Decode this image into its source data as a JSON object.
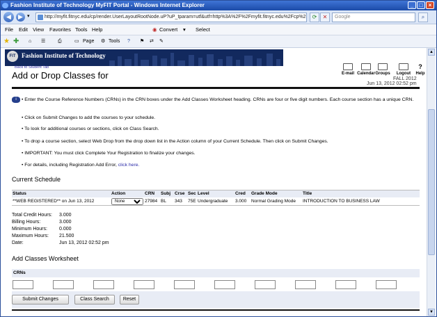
{
  "window": {
    "title": "Fashion Institute of Technology MyFIT Portal - Windows Internet Explorer",
    "min": "_",
    "max": "□",
    "close": "×"
  },
  "browser": {
    "url": "http://myfit.fitnyc.edu/cp/render.UserLayoutRootNode.uP?uP_tparam=utf&utf=http%3A%2F%2Fmyfit.fitnyc.edu%2Fcp%2",
    "search_placeholder": "Google"
  },
  "menu": [
    "File",
    "Edit",
    "View",
    "Favorites",
    "Tools",
    "Help"
  ],
  "menu_extra": {
    "convert": "Convert",
    "select": "Select"
  },
  "toolbar": {
    "page": "Page",
    "tools": "Tools"
  },
  "banner": {
    "logo": "FIT",
    "name": "Fashion Institute of Technology"
  },
  "back_link": "Back to Student Tab",
  "page_title": "Add or Drop Classes for",
  "top_tools": [
    {
      "label": "E-mail"
    },
    {
      "label": "Calendar"
    },
    {
      "label": "Groups"
    },
    {
      "label": "Logout"
    },
    {
      "label": "Help"
    }
  ],
  "term": "FALL 2012",
  "date_top": "Jun 13, 2012 02:52 pm",
  "instructions": [
    "Enter the Course Reference Numbers (CRNs) in the CRN boxes under the Add Classes Worksheet heading. CRNs are four or five digit numbers. Each course section has a unique CRN.",
    "Click on Submit Changes to add the courses to your schedule.",
    "To look for additional courses or sections, click on Class Search.",
    "To drop a course section, select Web Drop from the drop down list in the Action column of your Current Schedule. Then click on Submit Changes.",
    "IMPORTANT: You must click Complete Your Registration to finalize your changes.",
    "For details, including Registration Add Error,"
  ],
  "click_here": "click here.",
  "current_schedule": {
    "heading": "Current Schedule",
    "columns": [
      "Status",
      "Action",
      "CRN",
      "Subj",
      "Crse",
      "Sec",
      "Level",
      "Cred",
      "Grade Mode",
      "Title"
    ],
    "row": {
      "status": "**WEB REGISTERED** on Jun 13, 2012",
      "action": "None",
      "crn": "27984",
      "subj": "BL",
      "crse": "343",
      "sec": "75E",
      "level": "Undergraduate",
      "cred": "3.000",
      "grade_mode": "Normal Grading Mode",
      "title": "INTRODUCTION TO BUSINESS LAW"
    }
  },
  "totals": [
    {
      "label": "Total Credit Hours:",
      "value": "3.000"
    },
    {
      "label": "Billing Hours:",
      "value": "3.000"
    },
    {
      "label": "Minimum Hours:",
      "value": "0.000"
    },
    {
      "label": "Maximum Hours:",
      "value": "21.500"
    },
    {
      "label": "Date:",
      "value": "Jun 13, 2012 02:52 pm"
    }
  ],
  "worksheet": {
    "heading": "Add Classes Worksheet",
    "crns_label": "CRNs"
  },
  "buttons": {
    "submit": "Submit Changes",
    "search": "Class Search",
    "reset": "Reset"
  }
}
